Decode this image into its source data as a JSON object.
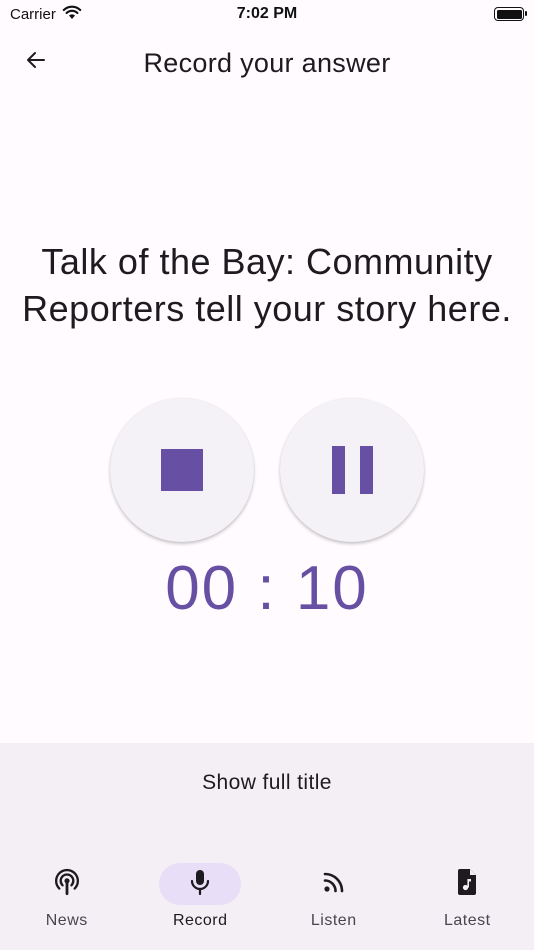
{
  "status_bar": {
    "carrier": "Carrier",
    "time": "7:02 PM"
  },
  "app_bar": {
    "title": "Record your answer",
    "back_icon": "arrow-left-icon"
  },
  "question": {
    "text": "Talk of the Bay: Community Reporters tell your story here."
  },
  "controls": {
    "stop_icon": "stop-icon",
    "pause_icon": "pause-icon"
  },
  "timer": {
    "text": "00 : 10"
  },
  "bottom": {
    "show_full_title": "Show full title"
  },
  "nav": {
    "items": [
      {
        "label": "News",
        "icon": "podcast-icon",
        "active": false
      },
      {
        "label": "Record",
        "icon": "microphone-icon",
        "active": true
      },
      {
        "label": "Listen",
        "icon": "rss-icon",
        "active": false
      },
      {
        "label": "Latest",
        "icon": "music-file-icon",
        "active": false
      }
    ]
  },
  "colors": {
    "accent": "#6750a4",
    "active_pill": "#e8def8",
    "background": "#fffbfe",
    "panel": "#f3eff5"
  }
}
